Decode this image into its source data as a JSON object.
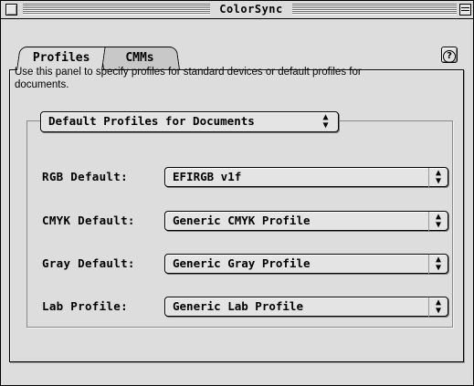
{
  "window": {
    "title": "ColorSync"
  },
  "tabs": [
    {
      "label": "Profiles",
      "selected": true
    },
    {
      "label": "CMMs",
      "selected": false
    }
  ],
  "help_button": {
    "icon": "question-mark-icon",
    "label": "?"
  },
  "description": "Use this panel to specify profiles for standard devices or default profiles for documents.",
  "group": {
    "selector_value": "Default Profiles for Documents",
    "rows": [
      {
        "label": "RGB Default:",
        "value": "EFIRGB v1f"
      },
      {
        "label": "CMYK Default:",
        "value": "Generic CMYK Profile"
      },
      {
        "label": "Gray Default:",
        "value": "Generic Gray Profile"
      },
      {
        "label": "Lab Profile:",
        "value": "Generic Lab Profile"
      }
    ]
  },
  "colors": {
    "window_bg": "#dddddd",
    "popup_bg": "#e4e4e4",
    "border": "#000000"
  }
}
